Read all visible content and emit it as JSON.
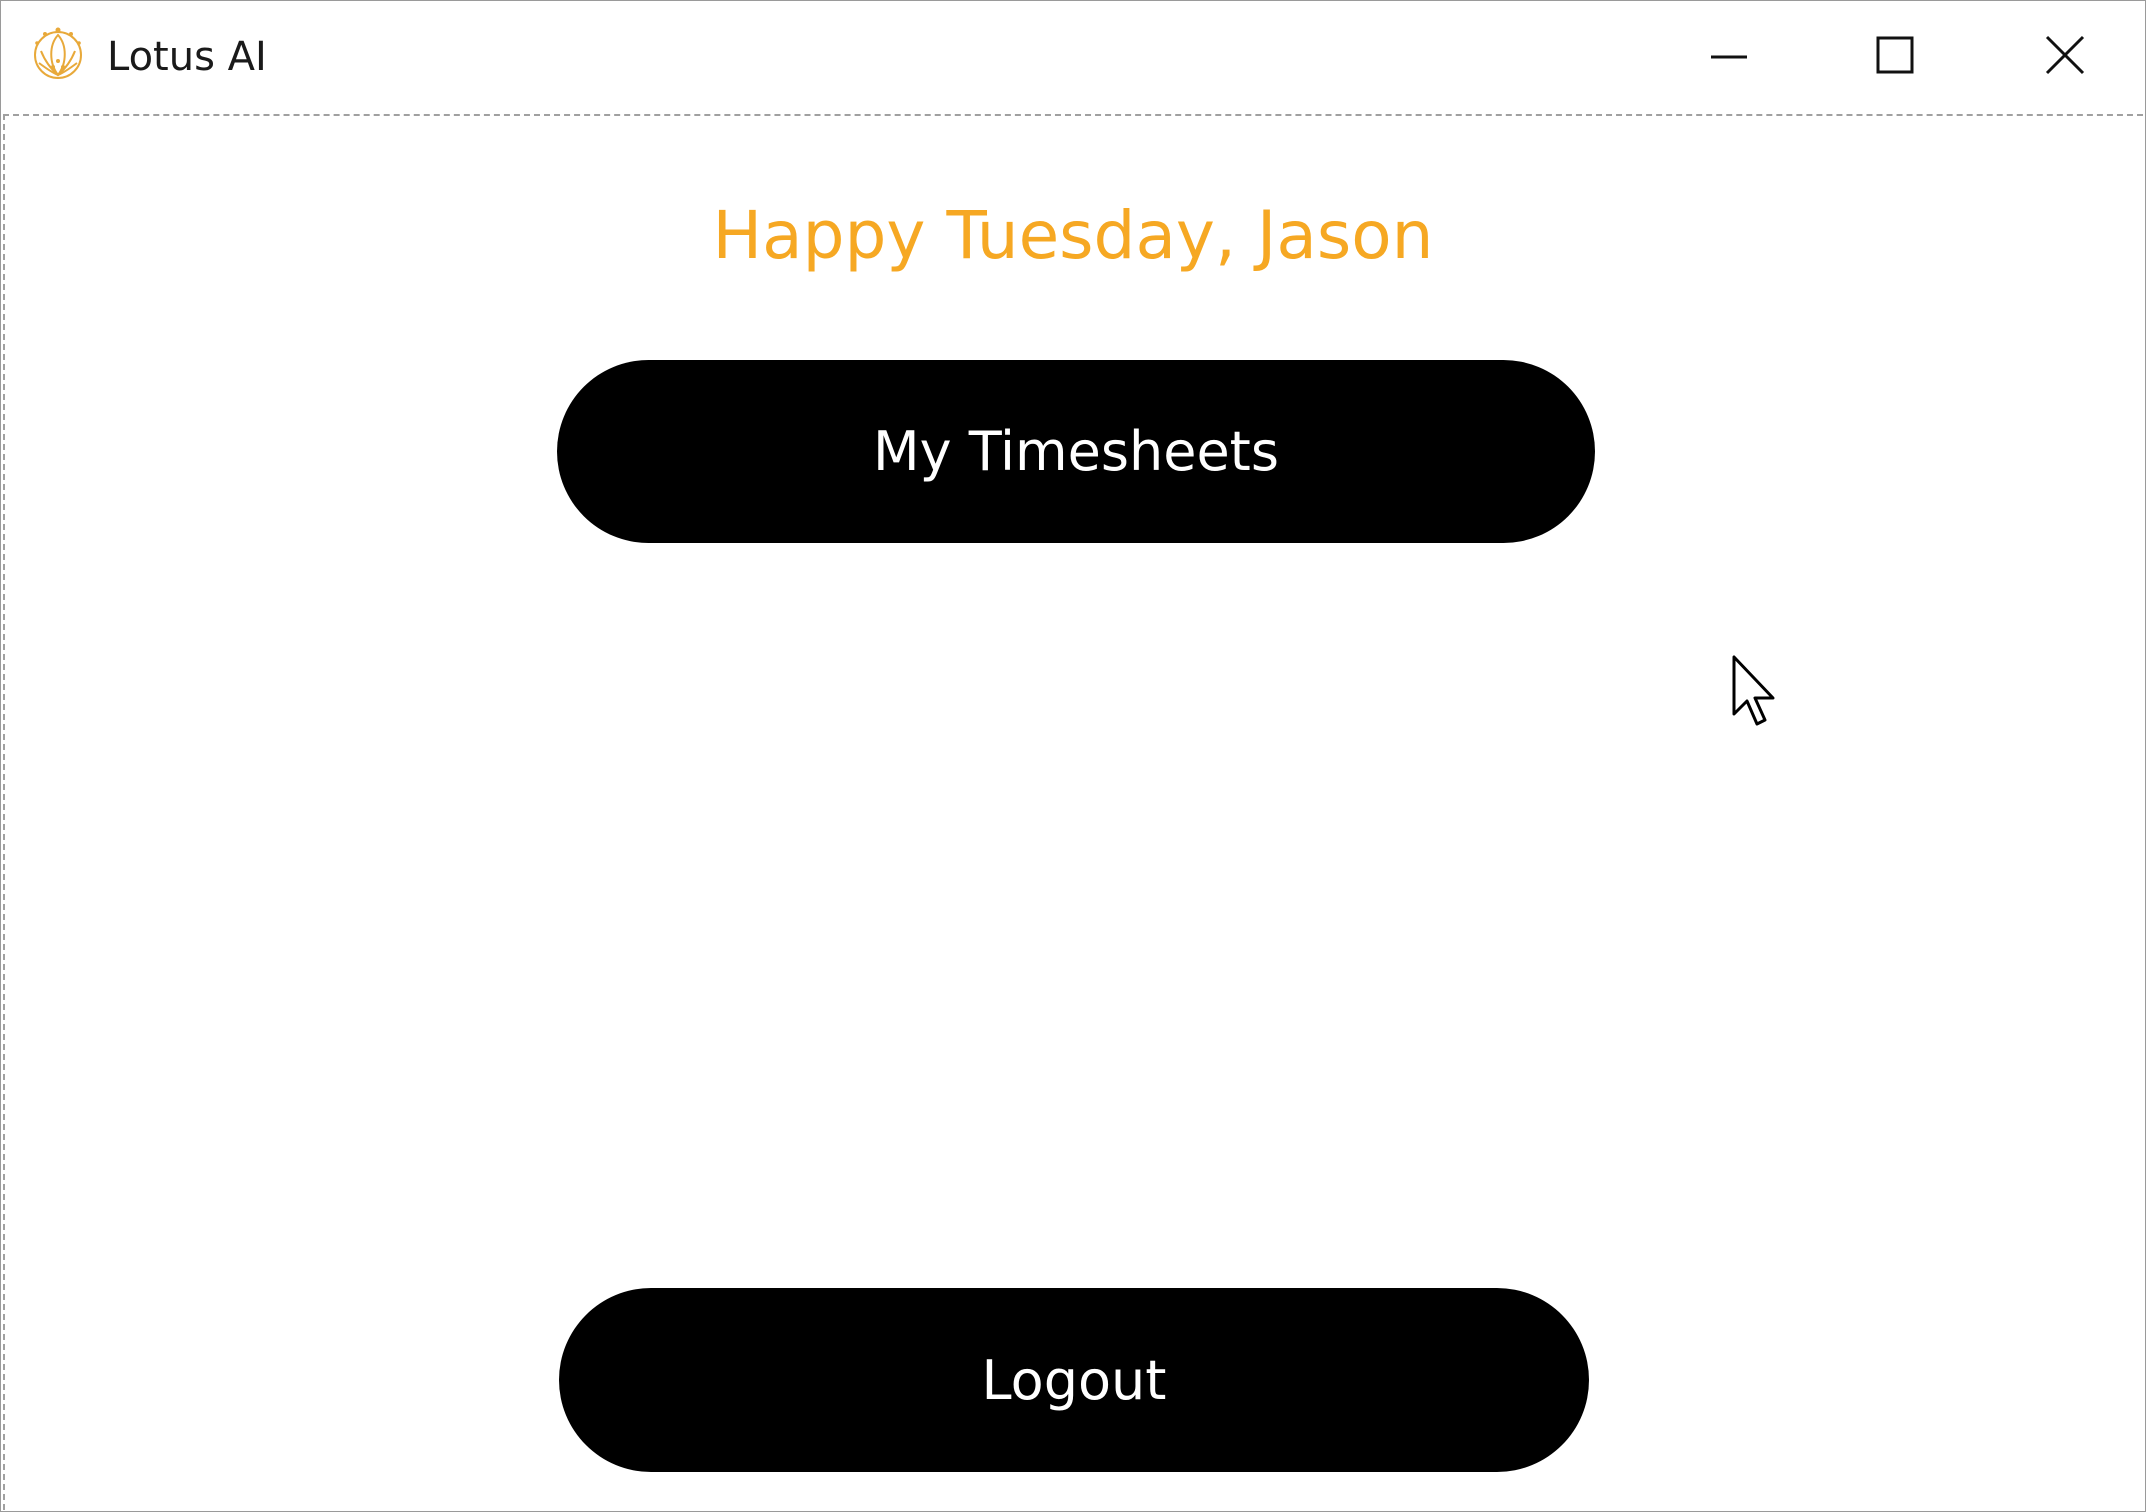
{
  "window": {
    "title": "Lotus AI",
    "icon": "lotus-logo-icon",
    "controls": {
      "minimize": "minimize-icon",
      "maximize": "maximize-icon",
      "close": "close-icon"
    }
  },
  "main": {
    "greeting": "Happy Tuesday, Jason",
    "timesheets_label": "My Timesheets",
    "logout_label": "Logout"
  },
  "colors": {
    "accent": "#f6a823",
    "button_bg": "#000000",
    "button_text": "#ffffff"
  }
}
